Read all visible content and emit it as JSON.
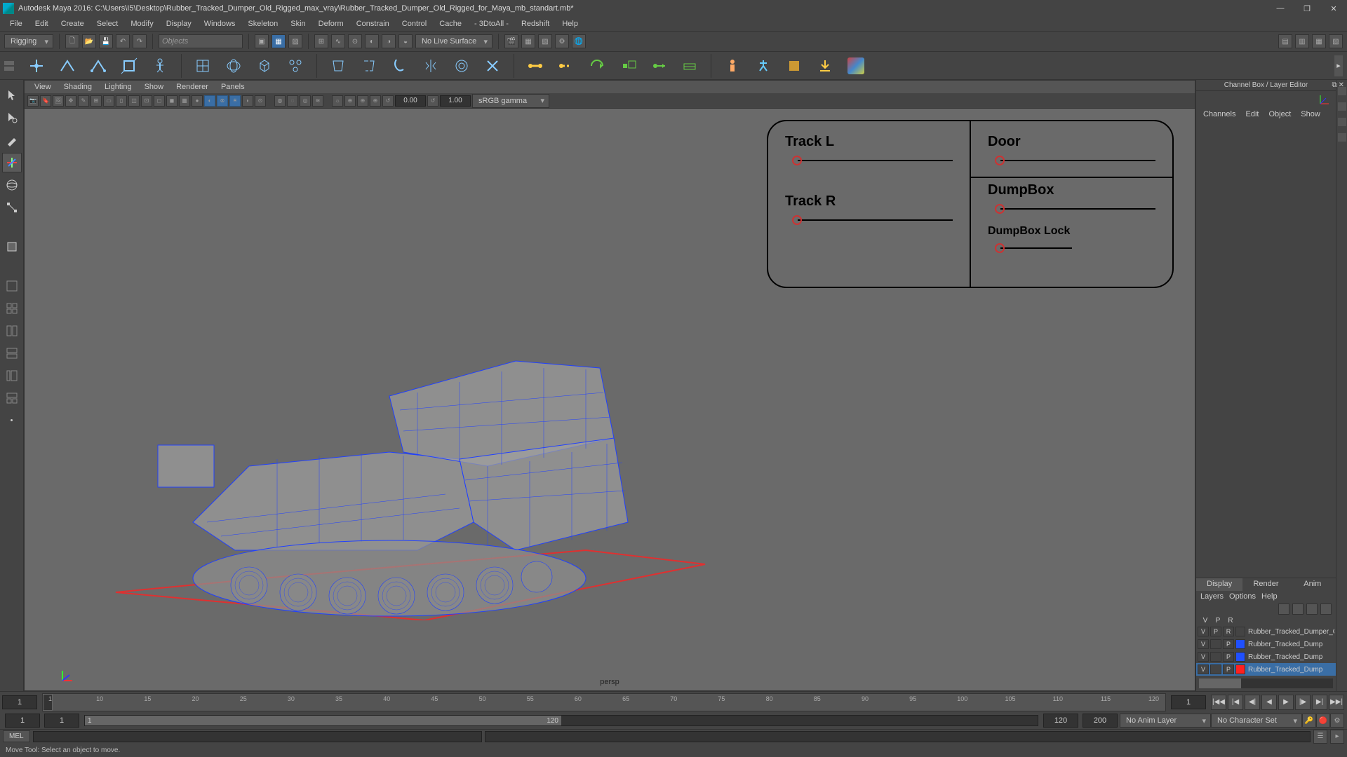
{
  "title": "Autodesk Maya 2016: C:\\Users\\I5\\Desktop\\Rubber_Tracked_Dumper_Old_Rigged_max_vray\\Rubber_Tracked_Dumper_Old_Rigged_for_Maya_mb_standart.mb*",
  "menubar": [
    "File",
    "Edit",
    "Create",
    "Select",
    "Modify",
    "Display",
    "Windows",
    "Skeleton",
    "Skin",
    "Deform",
    "Constrain",
    "Control",
    "Cache",
    "- 3DtoAll -",
    "Redshift",
    "Help"
  ],
  "mode_dropdown": "Rigging",
  "search_placeholder": "Objects",
  "surface_dropdown": "No Live Surface",
  "vp_menubar": [
    "View",
    "Shading",
    "Lighting",
    "Show",
    "Renderer",
    "Panels"
  ],
  "vp_num1": "0.00",
  "vp_num2": "1.00",
  "vp_gamma": "sRGB gamma",
  "persp": "persp",
  "ctrls": {
    "track_l": "Track L",
    "track_r": "Track R",
    "door": "Door",
    "dumpbox": "DumpBox",
    "dumpbox_lock": "DumpBox Lock"
  },
  "channelbox_title": "Channel Box / Layer Editor",
  "cb_tabs": [
    "Channels",
    "Edit",
    "Object",
    "Show"
  ],
  "layer_tabs": [
    "Display",
    "Render",
    "Anim"
  ],
  "layer_menu": [
    "Layers",
    "Options",
    "Help"
  ],
  "layers": [
    {
      "v": "V",
      "p": "P",
      "r": "R",
      "color": "",
      "name": "Rubber_Tracked_Dumper_Ol...",
      "sel": false
    },
    {
      "v": "V",
      "p": "",
      "r": "P",
      "color": "#2050ff",
      "name": "Rubber_Tracked_Dump",
      "sel": false
    },
    {
      "v": "V",
      "p": "",
      "r": "P",
      "color": "#2050ff",
      "name": "Rubber_Tracked_Dump",
      "sel": false
    },
    {
      "v": "V",
      "p": "",
      "r": "P",
      "color": "#ff2020",
      "name": "Rubber_Tracked_Dump",
      "sel": true
    }
  ],
  "ts_start": "1",
  "ts_end": "1",
  "rs_start": "1",
  "rs_cur": "1",
  "rs_val1": "120",
  "rs_val2": "120",
  "rs_val3": "200",
  "anim_layer": "No Anim Layer",
  "char_set": "No Character Set",
  "mel": "MEL",
  "helpline": "Move Tool: Select an object to move.",
  "ticks": [
    "1",
    "10",
    "15",
    "20",
    "25",
    "30",
    "35",
    "40",
    "45",
    "50",
    "55",
    "60",
    "65",
    "70",
    "75",
    "80",
    "85",
    "90",
    "95",
    "100",
    "105",
    "110",
    "115",
    "120"
  ]
}
